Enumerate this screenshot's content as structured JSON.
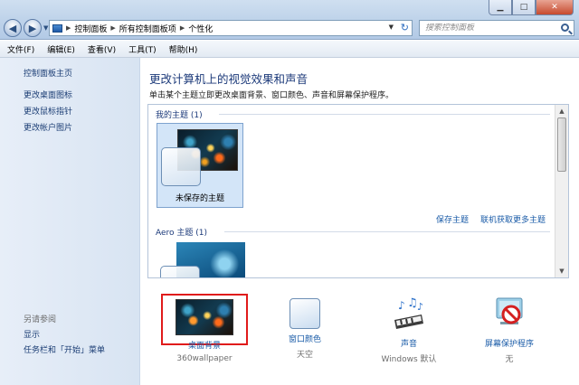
{
  "window": {
    "minimize_icon": "minimize-icon",
    "maximize_icon": "maximize-icon",
    "close_icon": "close-icon"
  },
  "nav": {
    "back_icon": "back-arrow-icon",
    "forward_icon": "forward-arrow-icon"
  },
  "address": {
    "crumbs": [
      "控制面板",
      "所有控制面板项",
      "个性化"
    ]
  },
  "search": {
    "placeholder": "搜索控制面板"
  },
  "menu": {
    "items": [
      "文件(F)",
      "编辑(E)",
      "查看(V)",
      "工具(T)",
      "帮助(H)"
    ]
  },
  "sidebar": {
    "home": "控制面板主页",
    "links": [
      "更改桌面图标",
      "更改鼠标指针",
      "更改帐户图片"
    ],
    "see_also_title": "另请参阅",
    "see_also_links": [
      "显示",
      "任务栏和「开始」菜单"
    ]
  },
  "main": {
    "title": "更改计算机上的视觉效果和声音",
    "description": "单击某个主题立即更改桌面背景、窗口颜色、声音和屏幕保护程序。",
    "my_themes_label": "我的主题 (1)",
    "unsaved_theme": "未保存的主题",
    "save_theme_link": "保存主题",
    "online_themes_link": "联机获取更多主题",
    "aero_label": "Aero 主题 (1)"
  },
  "bottom": {
    "items": [
      {
        "label": "桌面背景",
        "sub": "360wallpaper"
      },
      {
        "label": "窗口颜色",
        "sub": "天空"
      },
      {
        "label": "声音",
        "sub": "Windows 默认"
      },
      {
        "label": "屏幕保护程序",
        "sub": "无"
      }
    ]
  },
  "colors": {
    "link": "#1b5ca8",
    "title": "#1c3a7a",
    "highlight": "#e01b1b"
  }
}
